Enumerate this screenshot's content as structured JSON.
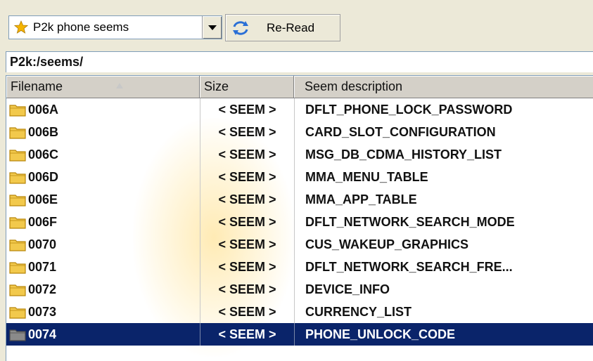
{
  "toolbar": {
    "combo_value": "P2k phone seems",
    "reread_label": "Re-Read"
  },
  "path": "P2k:/seems/",
  "table": {
    "headers": {
      "filename": "Filename",
      "size": "Size",
      "description": "Seem description"
    },
    "rows": [
      {
        "name": "006A",
        "size": "< SEEM >",
        "desc": "DFLT_PHONE_LOCK_PASSWORD"
      },
      {
        "name": "006B",
        "size": "< SEEM >",
        "desc": "CARD_SLOT_CONFIGURATION"
      },
      {
        "name": "006C",
        "size": "< SEEM >",
        "desc": "MSG_DB_CDMA_HISTORY_LIST"
      },
      {
        "name": "006D",
        "size": "< SEEM >",
        "desc": "MMA_MENU_TABLE"
      },
      {
        "name": "006E",
        "size": "< SEEM >",
        "desc": "MMA_APP_TABLE"
      },
      {
        "name": "006F",
        "size": "< SEEM >",
        "desc": "DFLT_NETWORK_SEARCH_MODE"
      },
      {
        "name": "0070",
        "size": "< SEEM >",
        "desc": "CUS_WAKEUP_GRAPHICS"
      },
      {
        "name": "0071",
        "size": "< SEEM >",
        "desc": "DFLT_NETWORK_SEARCH_FRE..."
      },
      {
        "name": "0072",
        "size": "< SEEM >",
        "desc": "DEVICE_INFO"
      },
      {
        "name": "0073",
        "size": "< SEEM >",
        "desc": "CURRENCY_LIST"
      },
      {
        "name": "0074",
        "size": "< SEEM >",
        "desc": "PHONE_UNLOCK_CODE"
      }
    ],
    "selected_row": 10
  },
  "colors": {
    "selection": "#0a246a",
    "folder": "#f2c94c"
  }
}
